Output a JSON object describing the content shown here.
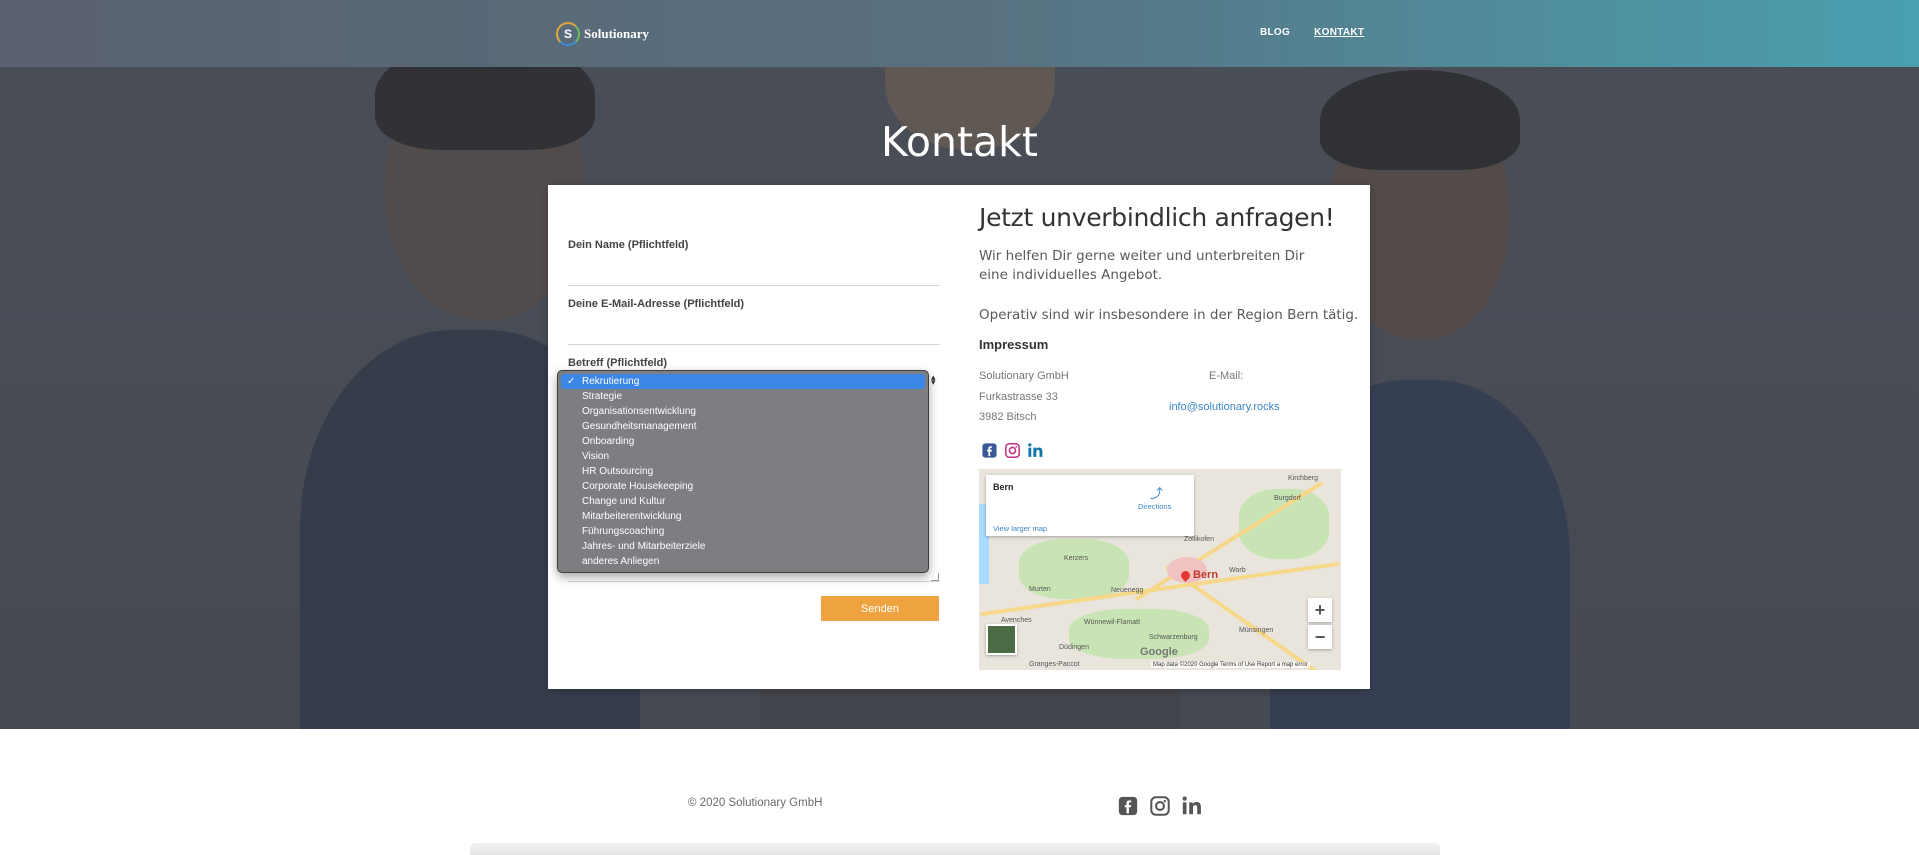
{
  "header": {
    "logo_mark": "S",
    "logo_text": "Solutionary",
    "nav": [
      {
        "label": "BLOG",
        "active": false
      },
      {
        "label": "KONTAKT",
        "active": true
      }
    ]
  },
  "hero": {
    "title": "Kontakt"
  },
  "form": {
    "name_label": "Dein Name (Pflichtfeld)",
    "name_value": "",
    "email_label": "Deine E-Mail-Adresse (Pflichtfeld)",
    "email_value": "",
    "subject_label": "Betreff (Pflichtfeld)",
    "subject_selected": "Rekrutierung",
    "subject_options": [
      "Rekrutierung",
      "Strategie",
      "Organisationsentwicklung",
      "Gesundheitsmanagement",
      "Onboarding",
      "Vision",
      "HR Outsourcing",
      "Corporate Housekeeping",
      "Change und Kultur",
      "Mitarbeiterentwicklung",
      "Führungscoaching",
      "Jahres- und Mitarbeiterziele",
      "anderes Anliegen"
    ],
    "check_glyph": "✓",
    "send_label": "Senden"
  },
  "info": {
    "heading": "Jetzt unverbindlich anfragen!",
    "text1": "Wir helfen Dir gerne weiter und unterbreiten Dir eine individuelles Angebot.",
    "text2": "Operativ sind wir insbesondere in der Region Bern tätig.",
    "impressum_title": "Impressum",
    "address": [
      "Solutionary GmbH",
      "Furkastrasse 33",
      "3982 Bitsch"
    ],
    "email_label": "E-Mail:",
    "email": "info@solutionary.rocks"
  },
  "map": {
    "place": "Bern",
    "directions": "Directions",
    "larger_map": "View larger map",
    "city_label": "Bern",
    "zoom_in": "+",
    "zoom_out": "−",
    "google": "Google",
    "footer": "Map data ©2020 Google    Terms of Use    Report a map error",
    "towns": [
      "Kirchberg",
      "Burgdorf",
      "Zollikofen",
      "Kerzers",
      "Worb",
      "Murten",
      "Neuenegg",
      "Wünnewil-Flamatt",
      "Düdingen",
      "Münsingen",
      "Schwarzenburg",
      "Granges-Paccot",
      "Avenches"
    ]
  },
  "footer": {
    "copyright": "© 2020 Solutionary GmbH"
  },
  "colors": {
    "accent": "#efa340",
    "link": "#3a86c8",
    "select_highlight": "#3c86e8"
  }
}
